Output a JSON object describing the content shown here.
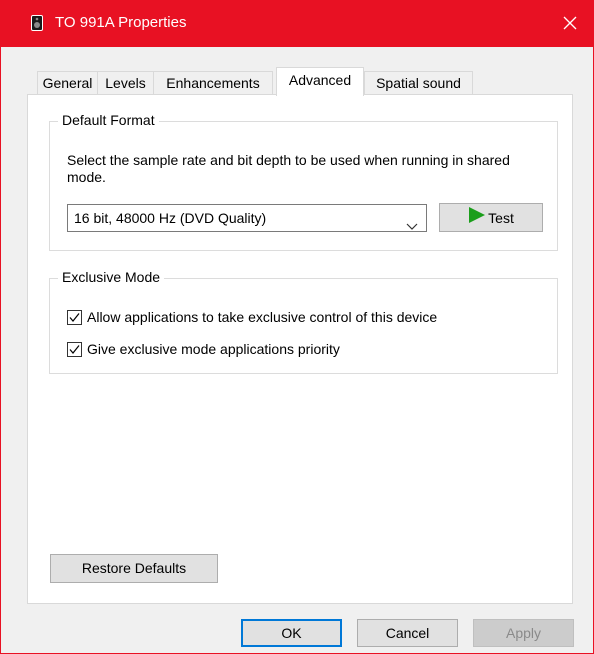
{
  "window": {
    "title": "TO 991A Properties",
    "title_icon": "speaker-device-icon",
    "close_icon": "close-icon",
    "titlebar_color": "#e81123"
  },
  "tabs": [
    {
      "label": "General",
      "active": false
    },
    {
      "label": "Levels",
      "active": false
    },
    {
      "label": "Enhancements",
      "active": false
    },
    {
      "label": "Advanced",
      "active": true
    },
    {
      "label": "Spatial sound",
      "active": false
    }
  ],
  "default_format": {
    "legend": "Default Format",
    "description": "Select the sample rate and bit depth to be used when running in shared mode.",
    "selected_format": "16 bit, 48000 Hz (DVD Quality)",
    "test_label": "Test",
    "test_icon": "play-icon"
  },
  "exclusive_mode": {
    "legend": "Exclusive Mode",
    "allow_label": "Allow applications to take exclusive control of this device",
    "allow_checked": true,
    "priority_label": "Give exclusive mode applications priority",
    "priority_checked": true
  },
  "restore_defaults_label": "Restore Defaults",
  "buttons": {
    "ok": "OK",
    "cancel": "Cancel",
    "apply": "Apply"
  }
}
